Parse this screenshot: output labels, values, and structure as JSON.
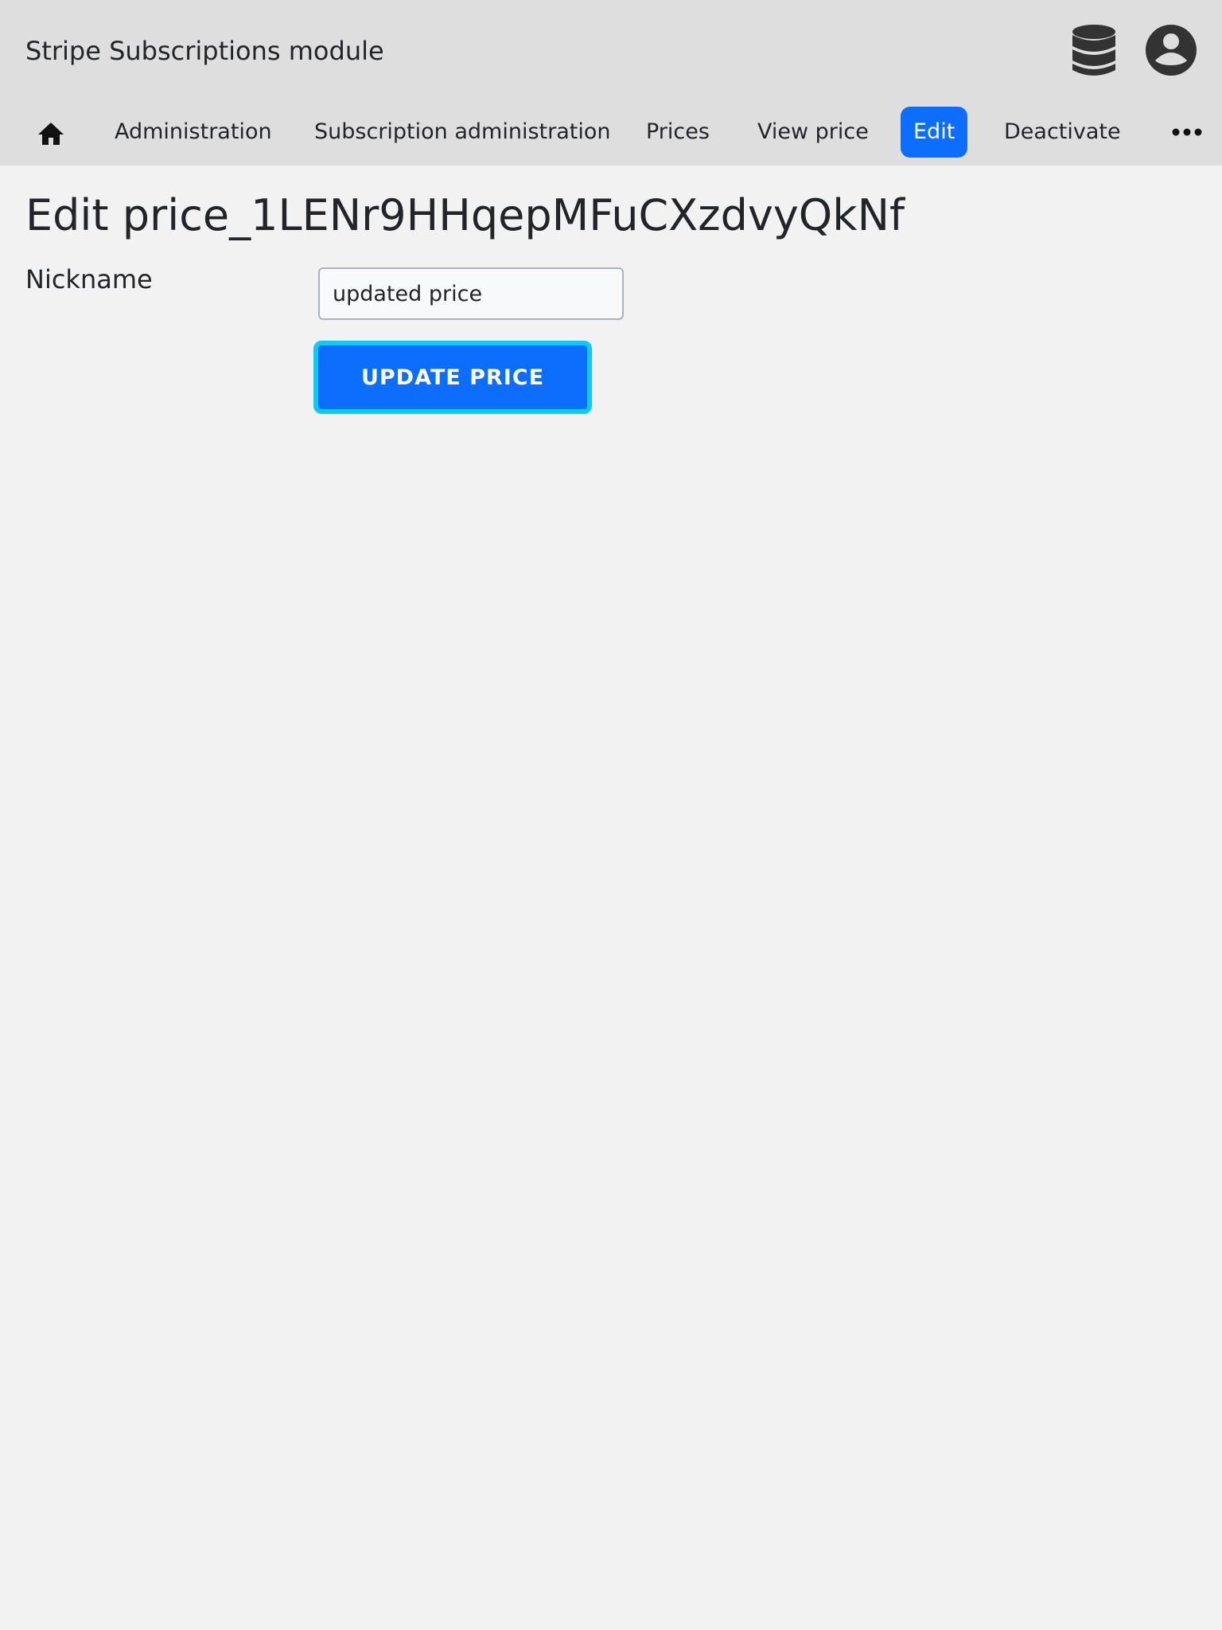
{
  "header": {
    "title": "Stripe Subscriptions module",
    "icons": [
      "database-icon",
      "user-circle-icon"
    ]
  },
  "nav": {
    "home_icon": "home-icon",
    "items": [
      {
        "label": "Administration"
      },
      {
        "label": "Subscription administration"
      },
      {
        "label": "Prices"
      },
      {
        "label": "View price"
      },
      {
        "label": "Edit",
        "active": true
      },
      {
        "label": "Deactivate"
      }
    ],
    "more_icon": "ellipsis-icon"
  },
  "main": {
    "title": "Edit price_1LENr9HHqepMFuCXzdvyQkNf",
    "form": {
      "nickname_label": "Nickname",
      "nickname_value": "updated price",
      "submit_label": "UPDATE PRICE"
    }
  },
  "colors": {
    "header_bg": "#dedede",
    "page_bg": "#f2f2f2",
    "accent": "#0d6efd",
    "focus_ring": "#0dcaf0",
    "icon": "#333333"
  }
}
